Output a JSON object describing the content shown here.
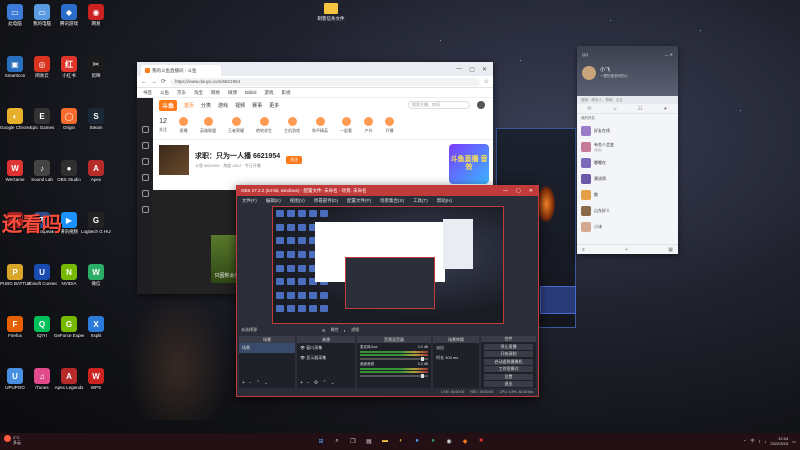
{
  "desktop": {
    "overlay_text": "还看吗",
    "top_folder": "刺客信条文件",
    "icons": [
      {
        "label": "此电脑",
        "color": "#3d7bd8",
        "glyph": "▭"
      },
      {
        "label": "我的电脑",
        "color": "#5a9ae0",
        "glyph": "▭"
      },
      {
        "label": "腾讯游戏",
        "color": "#2a6cc9",
        "glyph": "◆"
      },
      {
        "label": "网易",
        "color": "#c22",
        "glyph": "◉"
      },
      {
        "label": "SmartIcon",
        "color": "#2a70c0",
        "glyph": "▣"
      },
      {
        "label": "网易云",
        "color": "#d8341f",
        "glyph": "◎"
      },
      {
        "label": "小红书",
        "color": "#e0352b",
        "glyph": "红"
      },
      {
        "label": "剪映",
        "color": "#1a1a1a",
        "glyph": "✂"
      },
      {
        "label": "Google Chrome",
        "color": "#e8b02a",
        "glyph": "◐"
      },
      {
        "label": "Epic Games",
        "color": "#333",
        "glyph": "E"
      },
      {
        "label": "Origin",
        "color": "#f56c2d",
        "glyph": "◯"
      },
      {
        "label": "Steam",
        "color": "#1b2838",
        "glyph": "S"
      },
      {
        "label": "WeGame",
        "color": "#d33",
        "glyph": "W"
      },
      {
        "label": "Sound Lab",
        "color": "#444",
        "glyph": "♪"
      },
      {
        "label": "OBS Studio",
        "color": "#302e31",
        "glyph": "●"
      },
      {
        "label": "Apex",
        "color": "#b62a2a",
        "glyph": "A"
      },
      {
        "label": "Dota 2",
        "color": "#a22",
        "glyph": "D"
      },
      {
        "label": "TeamSpeak",
        "color": "#2a4f8a",
        "glyph": "T"
      },
      {
        "label": "腾讯视频",
        "color": "#1b92ff",
        "glyph": "▶"
      },
      {
        "label": "Logitech G HUB",
        "color": "#222",
        "glyph": "G"
      },
      {
        "label": "PUBG BATTLEGR",
        "color": "#d9a52b",
        "glyph": "P"
      },
      {
        "label": "Ubisoft Connect",
        "color": "#1a4bb0",
        "glyph": "U"
      },
      {
        "label": "NVIDIA",
        "color": "#76b900",
        "glyph": "N"
      },
      {
        "label": "微信",
        "color": "#2aae67",
        "glyph": "W"
      },
      {
        "label": "Firefox",
        "color": "#e66000",
        "glyph": "F"
      },
      {
        "label": "iQIYI",
        "color": "#00c05a",
        "glyph": "Q"
      },
      {
        "label": "GeForce Experience",
        "color": "#76b900",
        "glyph": "G"
      },
      {
        "label": "Xsplit",
        "color": "#2b7bd8",
        "glyph": "X"
      },
      {
        "label": "UPUPOO",
        "color": "#4a90e2",
        "glyph": "U"
      },
      {
        "label": "iTunes",
        "color": "#e24a8c",
        "glyph": "♫"
      },
      {
        "label": "Apex Legends",
        "color": "#b62a2a",
        "glyph": "A"
      },
      {
        "label": "WPS",
        "color": "#c22",
        "glyph": "W"
      }
    ]
  },
  "browser": {
    "tab_title": "我的斗鱼直播间 - 斗鱼",
    "url": "https://www.douyu.com/6621954",
    "bookmarks": [
      "书签",
      "斗鱼",
      "京东",
      "淘宝",
      "网易",
      "微博",
      "Bilibili",
      "游戏",
      "影视"
    ],
    "site": {
      "logo": "斗鱼",
      "nav": [
        "首页",
        "分类",
        "游戏",
        "视频",
        "赛事",
        "更多"
      ],
      "search_placeholder": "搜索主播、房间",
      "categories": [
        {
          "label": "关注",
          "num": "12"
        },
        {
          "label": "直播"
        },
        {
          "label": "英雄联盟"
        },
        {
          "label": "王者荣耀"
        },
        {
          "label": "绝地求生"
        },
        {
          "label": "主机游戏"
        },
        {
          "label": "和平精英"
        },
        {
          "label": "一起看"
        },
        {
          "label": "户外"
        },
        {
          "label": "开播"
        }
      ],
      "stream_title": "求职：只为一人播 6621954",
      "stream_sub": "斗鱼 6621954 · 热度 4512 · 今日开播",
      "follow": "关注",
      "promo": "斗鱼直播 音效",
      "game_thumb_label": "只因你太美"
    }
  },
  "obs": {
    "title": "OBS 27.2.2 (64-bit, windows) - 配置文件: 未命名 - 场景: 未命名",
    "menu": [
      "文件(F)",
      "编辑(E)",
      "视图(V)",
      "停靠部件(D)",
      "配置文件(P)",
      "场景集合(S)",
      "工具(T)",
      "帮助(H)"
    ],
    "toolbar_label": "未选择源",
    "toolbar_props": "属性",
    "toolbar_filters": "滤镜",
    "docks": {
      "scenes": {
        "header": "场景",
        "items": [
          "场景"
        ]
      },
      "sources": {
        "header": "来源",
        "items": [
          "窗口采集",
          "显示器采集"
        ]
      },
      "mixer": {
        "header": "音频混音器",
        "channels": [
          {
            "name": "麦克风/Aux",
            "db": "0.0 dB"
          },
          {
            "name": "桌面音频",
            "db": "0.0 dB"
          }
        ]
      },
      "transitions": {
        "header": "场景转换",
        "type": "淡出",
        "duration_label": "时长",
        "duration": "300 ms"
      },
      "controls": {
        "header": "控件",
        "buttons": [
          "停止直播",
          "开始录制",
          "启动虚拟摄像机",
          "工作室模式",
          "设置",
          "退出"
        ]
      }
    },
    "status": [
      "LIVE: 00:00:00",
      "REC: 00:00:00",
      "CPU: 3.9%, 60.00 fps"
    ]
  },
  "qq": {
    "top_left": "QQ",
    "name": "小飞",
    "signature": "一颗热爱游戏的心",
    "search_placeholder": "搜索：联系人、群聊、企业",
    "group_label": "我的好友",
    "contacts": [
      {
        "name": "好友在线",
        "msg": "",
        "color": "#9a7bc8"
      },
      {
        "name": "有些人会变",
        "msg": "[离线]",
        "color": "#c67a9a"
      },
      {
        "name": "嘟嘟在",
        "msg": "",
        "color": "#7b6ab8"
      },
      {
        "name": "潮流哥",
        "msg": "",
        "color": "#6c59a8"
      },
      {
        "name": "鲸",
        "msg": "",
        "color": "#e6a04a"
      },
      {
        "name": "山东好人",
        "msg": "",
        "color": "#8a6a4a"
      },
      {
        "name": "小沫",
        "msg": "",
        "color": "#d4a890"
      }
    ]
  },
  "taskbar": {
    "weather": "2°C",
    "weather_sub": "多云",
    "time": "12:04",
    "date": "2022/3/15",
    "tray": "中"
  }
}
